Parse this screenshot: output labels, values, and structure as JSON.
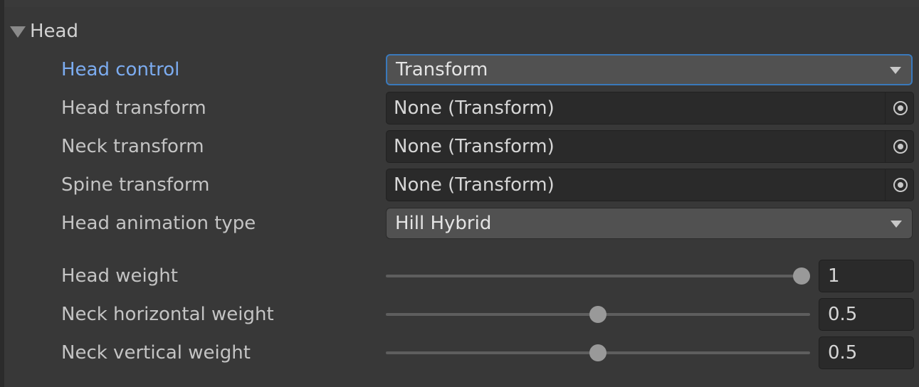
{
  "section": {
    "title": "Head",
    "expanded": true
  },
  "fields": {
    "head_control": {
      "label": "Head control",
      "value": "Transform",
      "focused": true
    },
    "head_transform": {
      "label": "Head transform",
      "value": "None (Transform)",
      "picker_icon": "object-picker-icon"
    },
    "neck_transform": {
      "label": "Neck transform",
      "value": "None (Transform)",
      "picker_icon": "object-picker-icon"
    },
    "spine_transform": {
      "label": "Spine transform",
      "value": "None (Transform)",
      "picker_icon": "object-picker-icon"
    },
    "head_animation_type": {
      "label": "Head animation type",
      "value": "Hill Hybrid"
    },
    "head_weight": {
      "label": "Head weight",
      "value": "1",
      "fraction": 1.0
    },
    "neck_horizontal_weight": {
      "label": "Neck horizontal weight",
      "value": "0.5",
      "fraction": 0.5
    },
    "neck_vertical_weight": {
      "label": "Neck vertical weight",
      "value": "0.5",
      "fraction": 0.5
    }
  },
  "colors": {
    "background": "#383838",
    "focused_label": "#7cacf0",
    "focus_border": "#3a79bb",
    "field_dark": "#2a2a2a",
    "dropdown_bg": "#515151",
    "slider_thumb": "#999999"
  }
}
